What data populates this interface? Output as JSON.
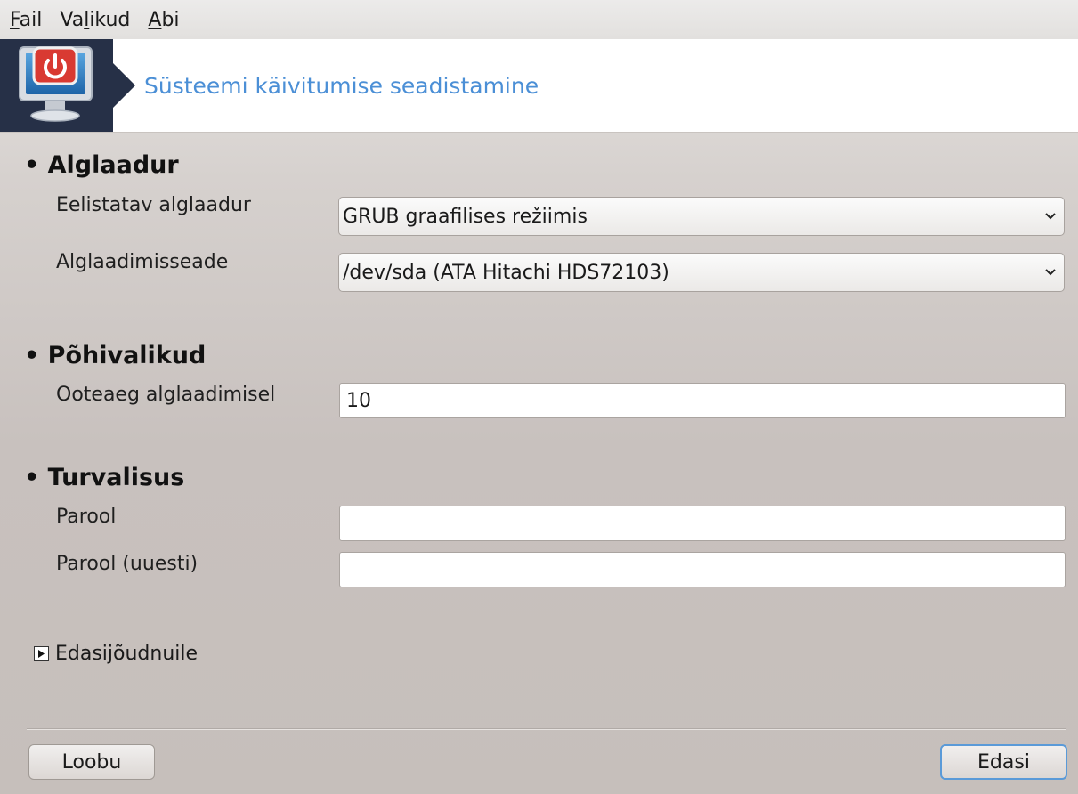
{
  "menubar": {
    "items": [
      {
        "mnemonic": "F",
        "rest": "ail"
      },
      {
        "pre": "Va",
        "mnemonic": "l",
        "rest": "ikud"
      },
      {
        "mnemonic": "A",
        "rest": "bi"
      }
    ]
  },
  "banner": {
    "title": "Süsteemi käivitumise seadistamine",
    "icon": "power-monitor-icon"
  },
  "sections": {
    "bootloader": {
      "title": "• Alglaadur",
      "preferred_label": "Eelistatav alglaadur",
      "preferred_value": "GRUB graafilises režiimis",
      "device_label": "Alglaadimisseade",
      "device_value": "/dev/sda (ATA Hitachi HDS72103)"
    },
    "main_options": {
      "title": "• Põhivalikud",
      "timeout_label": "Ooteaeg alglaadimisel",
      "timeout_value": "10"
    },
    "security": {
      "title": "• Turvalisus",
      "password_label": "Parool",
      "password_value": "",
      "password_again_label": "Parool (uuesti)",
      "password_again_value": ""
    }
  },
  "advanced": {
    "label": "Edasijõudnuile"
  },
  "buttons": {
    "cancel": "Loobu",
    "next": "Edasi"
  },
  "colors": {
    "banner_bg": "#263047",
    "title_accent": "#4b8fd6",
    "power_red": "#d93a32"
  }
}
